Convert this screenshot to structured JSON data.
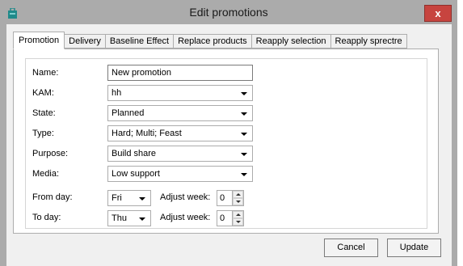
{
  "window": {
    "title": "Edit promotions",
    "close_label": "x"
  },
  "tabs": [
    {
      "label": "Promotion",
      "active": true
    },
    {
      "label": "Delivery"
    },
    {
      "label": "Baseline Effect"
    },
    {
      "label": "Replace products"
    },
    {
      "label": "Reapply selection"
    },
    {
      "label": "Reapply sprectre"
    }
  ],
  "form": {
    "name": {
      "label": "Name:",
      "value": "New promotion"
    },
    "kam": {
      "label": "KAM:",
      "value": "hh"
    },
    "state": {
      "label": "State:",
      "value": "Planned"
    },
    "type": {
      "label": "Type:",
      "value": "Hard; Multi; Feast"
    },
    "purpose": {
      "label": "Purpose:",
      "value": "Build share"
    },
    "media": {
      "label": "Media:",
      "value": "Low support"
    },
    "from_day": {
      "label": "From day:",
      "value": "Fri",
      "adjust_label": "Adjust week:",
      "adjust_value": "0"
    },
    "to_day": {
      "label": "To day:",
      "value": "Thu",
      "adjust_label": "Adjust week:",
      "adjust_value": "0"
    }
  },
  "buttons": {
    "cancel": "Cancel",
    "update": "Update"
  },
  "colors": {
    "titlebar": "#ababab",
    "close_button": "#c7443f",
    "app_icon": "#1f8a8a"
  },
  "icons": {
    "app": "app-icon",
    "close": "close-icon"
  }
}
